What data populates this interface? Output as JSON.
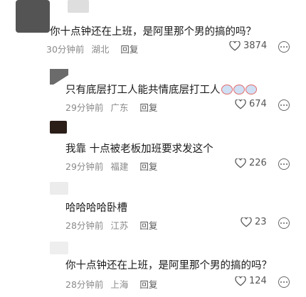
{
  "comments": [
    {
      "text": "你十点钟还在上班，是阿里那个男的搞的吗？",
      "time": "30分钟前",
      "location": "湖北",
      "reply": "回复",
      "likes": "3874"
    },
    {
      "text": "只有底层打工人能共情底层打工人",
      "time": "29分钟前",
      "location": "广东",
      "reply": "回复",
      "likes": "674"
    },
    {
      "text": "我靠 十点被老板加班要求发这个",
      "time": "29分钟前",
      "location": "福建",
      "reply": "回复",
      "likes": "226"
    },
    {
      "text": "哈哈哈哈卧槽",
      "time": "28分钟前",
      "location": "江苏",
      "reply": "回复",
      "likes": "23"
    },
    {
      "text": "你十点钟还在上班，是阿里那个男的搞的吗？",
      "time": "28分钟前",
      "location": "上海",
      "reply": "回复",
      "likes": "124"
    }
  ],
  "colors": {
    "text": "#1a1a1a",
    "meta": "#8a8a8a"
  },
  "icons": [
    "heart-icon",
    "more-icon",
    "emoji-icon"
  ]
}
